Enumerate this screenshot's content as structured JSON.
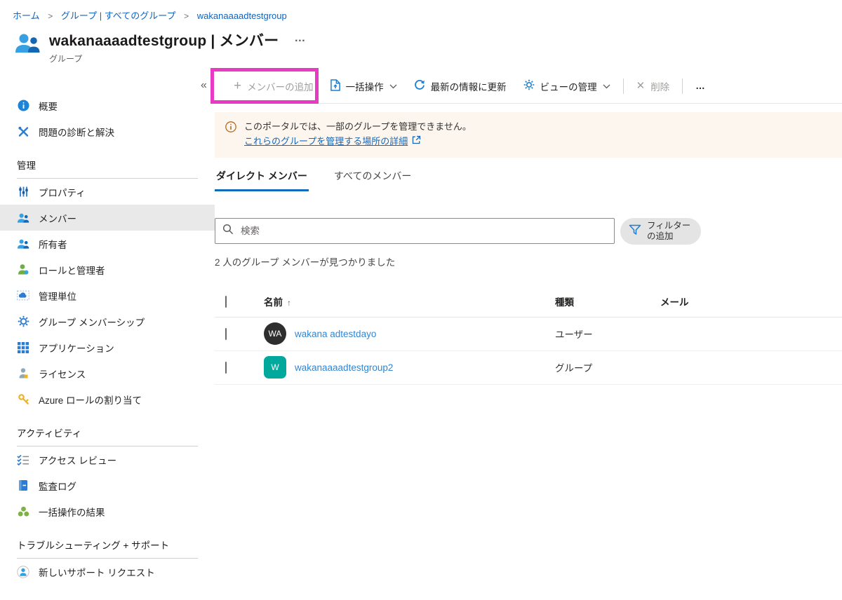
{
  "breadcrumb": {
    "separator": ">",
    "items": [
      "ホーム",
      "グループ | すべてのグループ",
      "wakanaaaadtestgroup"
    ]
  },
  "header": {
    "title": "wakanaaaadtestgroup | メンバー",
    "subtitle": "グループ",
    "more": "…"
  },
  "toolbar": {
    "collapse": "«",
    "plus": "+",
    "add_member": "メンバーの追加",
    "bulk_ops": "一括操作",
    "refresh": "最新の情報に更新",
    "manage_view": "ビューの管理",
    "delete_x": "✕",
    "delete_label": "削除",
    "more": "…"
  },
  "sidebar": {
    "sections": [
      {
        "items": [
          {
            "label": "概要"
          },
          {
            "label": "問題の診断と解決"
          }
        ]
      },
      {
        "header": "管理",
        "items": [
          {
            "label": "プロパティ"
          },
          {
            "label": "メンバー"
          },
          {
            "label": "所有者"
          },
          {
            "label": "ロールと管理者"
          },
          {
            "label": "管理単位"
          },
          {
            "label": "グループ メンバーシップ"
          },
          {
            "label": "アプリケーション"
          },
          {
            "label": "ライセンス"
          },
          {
            "label": "Azure ロールの割り当て"
          }
        ]
      },
      {
        "header": "アクティビティ",
        "items": [
          {
            "label": "アクセス レビュー"
          },
          {
            "label": "監査ログ"
          },
          {
            "label": "一括操作の結果"
          }
        ]
      },
      {
        "header": "トラブルシューティング + サポート",
        "items": [
          {
            "label": "新しいサポート リクエスト"
          }
        ]
      }
    ]
  },
  "banner": {
    "message": "このポータルでは、一部のグループを管理できません。",
    "link_text": "これらのグループを管理する場所の詳細"
  },
  "tabs": {
    "direct": "ダイレクト メンバー",
    "all": "すべてのメンバー"
  },
  "search": {
    "placeholder": "検索"
  },
  "filter": {
    "label": "フィルターの追加"
  },
  "status": "2 人のグループ メンバーが見つかりました",
  "table": {
    "columns": {
      "name": "名前",
      "type": "種類",
      "email": "メール"
    },
    "sort_arrow": "↑",
    "rows": [
      {
        "initials": "WA",
        "name": "wakana adtestdayo",
        "type": "ユーザー",
        "email": ""
      },
      {
        "initials": "W",
        "name": "wakanaaaadtestgroup2",
        "type": "グループ",
        "email": ""
      }
    ]
  },
  "colors": {
    "accent": "#0f6cbd",
    "highlight_box": "#e93ac4",
    "banner_bg": "#fdf6ee",
    "avatar_user": "#2e2e2e",
    "avatar_group": "#00a99c",
    "row_link": "#2f86d3"
  }
}
